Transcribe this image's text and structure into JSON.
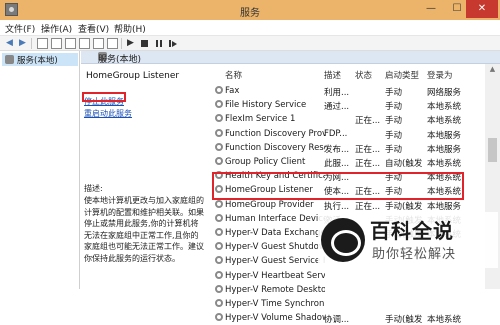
{
  "window": {
    "title": "服务",
    "min": "—",
    "max": "☐",
    "close": "✕"
  },
  "menu": [
    "文件(F)",
    "操作(A)",
    "查看(V)",
    "帮助(H)"
  ],
  "toolbar": {
    "back": "◀",
    "forward": "▶",
    "play": "▶"
  },
  "tree": {
    "item": "服务(本地)"
  },
  "pane_header": "服务(本地)",
  "detail": {
    "service_name": "HomeGroup Listener",
    "stop_link": "停止此服务",
    "restart_link": "重启动此服务",
    "desc_label": "描述:",
    "desc_text": "使本地计算机更改与加入家庭组的计算机的配置和维护相关联。如果停止或禁用此服务,你的计算机将无法在家庭组中正常工作,且你的家庭组也可能无法正常工作。建议你保持此服务的运行状态。"
  },
  "columns": {
    "name": "名称",
    "desc": "描述",
    "status": "状态",
    "start": "启动类型",
    "logon": "登录为"
  },
  "rows": [
    {
      "name": "Fax",
      "desc": "利用...",
      "status": "",
      "start": "手动",
      "logon": "网络服务"
    },
    {
      "name": "File History Service",
      "desc": "通过...",
      "status": "",
      "start": "手动",
      "logon": "本地系统"
    },
    {
      "name": "FlexIm Service 1",
      "desc": "",
      "status": "正在...",
      "start": "手动",
      "logon": "本地系统"
    },
    {
      "name": "Function Discovery Provi...",
      "desc": "FDP...",
      "status": "",
      "start": "手动",
      "logon": "本地服务"
    },
    {
      "name": "Function Discovery Reso...",
      "desc": "发布...",
      "status": "正在...",
      "start": "手动",
      "logon": "本地服务"
    },
    {
      "name": "Group Policy Client",
      "desc": "此服...",
      "status": "正在...",
      "start": "自动(触发...",
      "logon": "本地系统"
    },
    {
      "name": "Health Key and Certificat...",
      "desc": "为网...",
      "status": "",
      "start": "手动",
      "logon": "本地系统"
    },
    {
      "name": "HomeGroup Listener",
      "desc": "使本...",
      "status": "正在...",
      "start": "手动",
      "logon": "本地系统"
    },
    {
      "name": "HomeGroup Provider",
      "desc": "执行...",
      "status": "正在...",
      "start": "手动(触发...",
      "logon": "本地服务"
    },
    {
      "name": "Human Interface Device ...",
      "desc": "激活...",
      "status": "",
      "start": "手动(触发...",
      "logon": "本地系统"
    },
    {
      "name": "Hyper-V Data Exchange ...",
      "desc": "提供...",
      "status": "",
      "start": "手动(触发...",
      "logon": "本地系统"
    },
    {
      "name": "Hyper-V Guest Shutdown...",
      "desc": "",
      "status": "",
      "start": "",
      "logon": ""
    },
    {
      "name": "Hyper-V Guest Service I...",
      "desc": "",
      "status": "",
      "start": "",
      "logon": ""
    },
    {
      "name": "Hyper-V Heartbeat Service",
      "desc": "",
      "status": "",
      "start": "",
      "logon": ""
    },
    {
      "name": "Hyper-V Remote Desktop Virtualiz...",
      "desc": "",
      "status": "",
      "start": "",
      "logon": ""
    },
    {
      "name": "Hyper-V Time Synchroniz...",
      "desc": "",
      "status": "",
      "start": "",
      "logon": ""
    },
    {
      "name": "Hyper-V Volume Shadow ...",
      "desc": "协调...",
      "status": "",
      "start": "手动(触发...",
      "logon": "本地系统"
    }
  ],
  "watermark": {
    "title": "百科全说",
    "subtitle": "助你轻松解决"
  }
}
